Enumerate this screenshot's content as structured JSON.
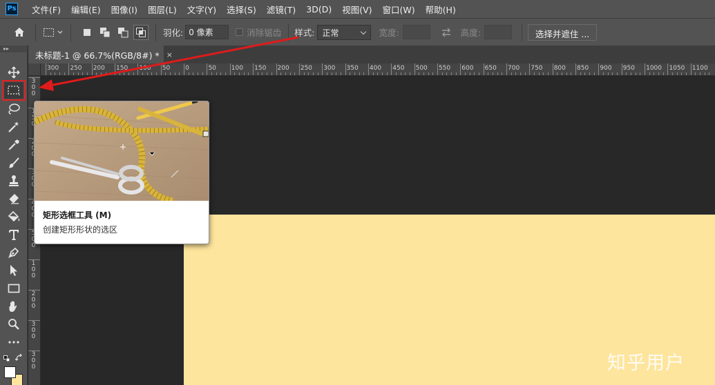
{
  "app": {
    "logo_text": "Ps",
    "menu": [
      "文件(F)",
      "编辑(E)",
      "图像(I)",
      "图层(L)",
      "文字(Y)",
      "选择(S)",
      "滤镜(T)",
      "3D(D)",
      "视图(V)",
      "窗口(W)",
      "帮助(H)"
    ]
  },
  "options_bar": {
    "feather_label": "羽化:",
    "feather_value": "0 像素",
    "antialias_label": "消除锯齿",
    "style_label": "样式:",
    "style_value": "正常",
    "width_label": "宽度:",
    "height_label": "高度:",
    "select_mask_button": "选择并遮住 ..."
  },
  "document": {
    "tab_title": "未标题-1 @ 66.7%(RGB/8#) *",
    "close_glyph": "×"
  },
  "ruler": {
    "top_labels": [
      "300",
      "250",
      "200",
      "150",
      "100",
      "50",
      "0",
      "50",
      "100",
      "150",
      "200",
      "250",
      "300",
      "350",
      "400",
      "450",
      "500",
      "550",
      "600",
      "650",
      "700",
      "750",
      "800",
      "850",
      "900",
      "950",
      "1000",
      "1050",
      "1100"
    ],
    "left_labels": [
      "3 0 0",
      "1 5 0",
      "2 0 0",
      "3 0 0",
      "4 0 0",
      "5 0 0",
      "1 0 0",
      "2 0 0",
      "3 0 0",
      "3 0 0"
    ]
  },
  "tooltip": {
    "title": "矩形选框工具 (M)",
    "description": "创建矩形形状的选区"
  },
  "canvas": {
    "artboard_color": "#fee59d",
    "background_color": "#282828"
  },
  "watermark": "知乎用户",
  "colors": {
    "highlight": "#e02121",
    "foreground": "#ffffff",
    "background": "#fee59d"
  },
  "tools": [
    "move-icon",
    "rectangular-marquee-icon",
    "lasso-icon",
    "magic-wand-icon",
    "eyedropper-icon",
    "brush-icon",
    "clone-stamp-icon",
    "eraser-icon",
    "paint-bucket-icon",
    "type-icon",
    "pen-icon",
    "path-selection-icon",
    "rectangle-shape-icon",
    "hand-icon",
    "zoom-icon",
    "more-tools-icon"
  ]
}
